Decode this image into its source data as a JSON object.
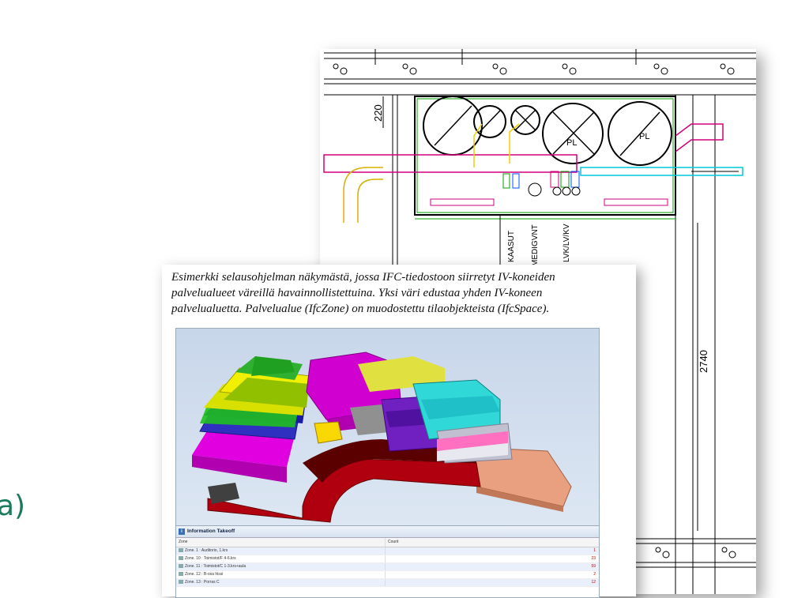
{
  "side_text": "a)",
  "cad": {
    "dim_220": "220",
    "dim_2740": "2740",
    "label_pl_1": "PL",
    "label_pl_2": "PL",
    "vertical_labels": [
      "KAASUT",
      "MEDIGVNT",
      "LVK/LV/KV"
    ]
  },
  "figure": {
    "caption_lines": [
      "Esimerkki selausohjelman näkymästä,  jossa IFC-tiedostoon siirretyt IV-koneiden",
      "palvelualueet väreillä havainnollistettuina. Yksi väri edustaa yhden IV-koneen",
      "palvelualuetta. Palvelualue (IfcZone) on muodostettu tilaobjekteista (IfcSpace)."
    ]
  },
  "takeoff": {
    "title": "Information Takeoff",
    "col_zone": "Zone",
    "col_count": "Count",
    "rows": [
      {
        "zone": "Zone. 1 : Auditorio, 1.krs",
        "count": "1"
      },
      {
        "zone": "Zone. 10 : Toimistot/F 4-6.krs",
        "count": "23"
      },
      {
        "zone": "Zone. 11 : Toimistot/C 1-3.krs+aula",
        "count": "59"
      },
      {
        "zone": "Zone. 12 : B-osa hissi",
        "count": "2"
      },
      {
        "zone": "Zone. 13 : Porras C",
        "count": "12"
      }
    ],
    "strip_colors": [
      "#ffd800",
      "#f08000",
      "#8a2be2",
      "#00b050",
      "#e000e0"
    ]
  },
  "colors": {
    "accent": "#1a7a5a",
    "cad_magenta": "#d0007a",
    "cad_green": "#00a000",
    "cad_cyan": "#00c8d8"
  }
}
